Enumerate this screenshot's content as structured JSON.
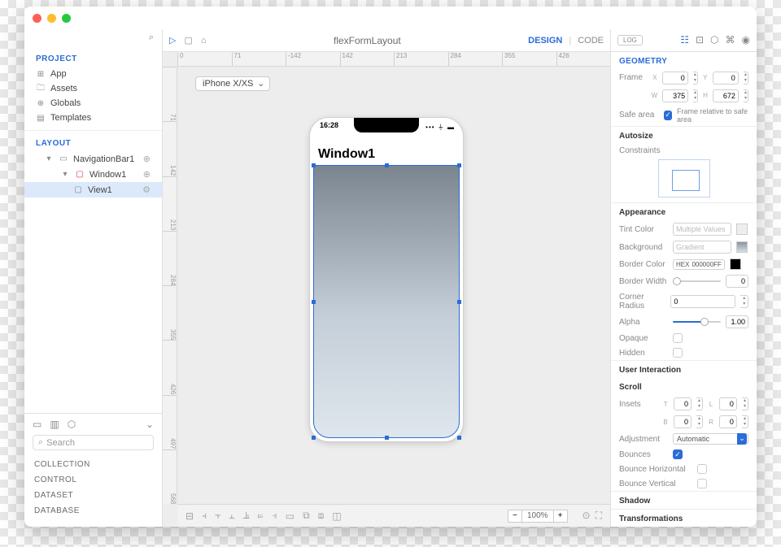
{
  "titlebar": {
    "title": "flexFormLayout"
  },
  "toolbar": {
    "tabs": {
      "design": "DESIGN",
      "code": "CODE"
    },
    "log_label": "LOG"
  },
  "sidebar": {
    "project_header": "PROJECT",
    "layout_header": "LAYOUT",
    "project_items": {
      "app": "App",
      "assets": "Assets",
      "globals": "Globals",
      "templates": "Templates"
    },
    "tree": {
      "nav": "NavigationBar1",
      "window": "Window1",
      "view": "View1"
    },
    "search_placeholder": "Search",
    "categories": [
      "COLLECTION",
      "CONTROL",
      "DATASET",
      "DATABASE"
    ]
  },
  "canvas": {
    "device": "iPhone X/XS",
    "ruler_h": [
      "0",
      "71",
      "-142",
      "142",
      "213",
      "284",
      "355",
      "426"
    ],
    "ruler_v": [
      "71",
      "142",
      "213",
      "284",
      "355",
      "426",
      "497",
      "568"
    ],
    "phone": {
      "time": "16:28",
      "title": "Window1"
    },
    "zoom": "100%"
  },
  "inspector": {
    "geometry_header": "GEOMETRY",
    "frame_label": "Frame",
    "frame": {
      "x": "0",
      "y": "0",
      "w": "375",
      "h": "672"
    },
    "safe_area_label": "Safe area",
    "safe_area_text": "Frame relative to safe area",
    "autosize_header": "Autosize",
    "constraints_label": "Constraints",
    "appearance_header": "Appearance",
    "tint_label": "Tint Color",
    "tint_placeholder": "Multiple Values",
    "bg_label": "Background",
    "bg_value": "Gradient",
    "border_color_label": "Border Color",
    "border_color_hex": "000000FF",
    "border_width_label": "Border Width",
    "border_width": "0",
    "corner_label": "Corner Radius",
    "corner": "0",
    "alpha_label": "Alpha",
    "alpha": "1.00",
    "opaque_label": "Opaque",
    "hidden_label": "Hidden",
    "ui_header": "User Interaction",
    "scroll_header": "Scroll",
    "insets_label": "Insets",
    "insets": {
      "t": "0",
      "l": "0",
      "b": "0",
      "r": "0"
    },
    "adjustment_label": "Adjustment",
    "adjustment_value": "Automatic",
    "bounces_label": "Bounces",
    "bh_label": "Bounce Horizontal",
    "bv_label": "Bounce Vertical",
    "shadow_header": "Shadow",
    "transform_header": "Transformations"
  }
}
